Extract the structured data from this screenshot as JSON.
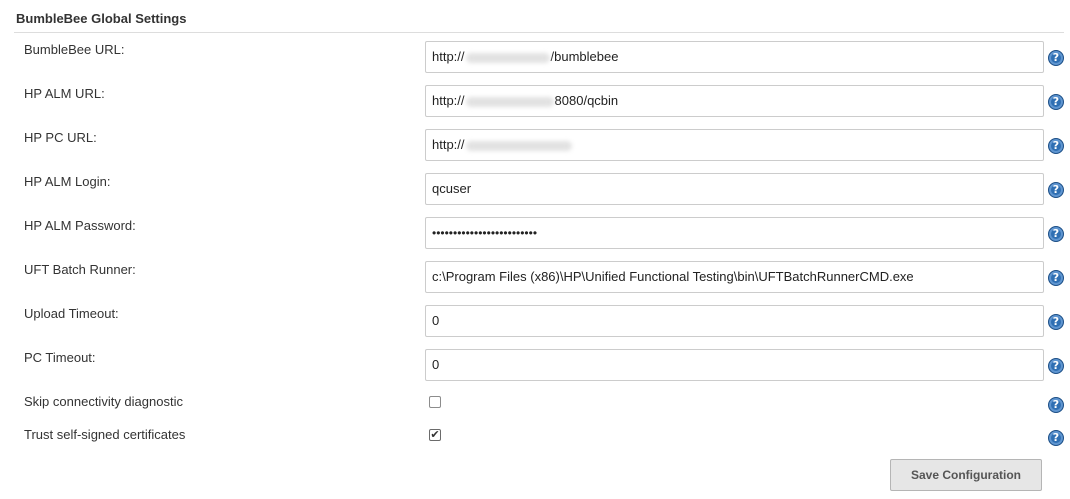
{
  "section": {
    "title": "BumbleBee Global Settings"
  },
  "fields": {
    "bumblebee_url": {
      "label": "BumbleBee URL:",
      "prefix": "http://",
      "suffix": "/bumblebee"
    },
    "alm_url": {
      "label": "HP ALM URL:",
      "prefix": "http://",
      "suffix": "8080/qcbin"
    },
    "pc_url": {
      "label": "HP PC URL:",
      "prefix": "http://",
      "suffix": ""
    },
    "alm_login": {
      "label": "HP ALM Login:",
      "value": "qcuser"
    },
    "alm_password": {
      "label": "HP ALM Password:",
      "value": "•••••••••••••••••••••••••"
    },
    "uft_runner": {
      "label": "UFT Batch Runner:",
      "value": "c:\\Program Files (x86)\\HP\\Unified Functional Testing\\bin\\UFTBatchRunnerCMD.exe"
    },
    "upload_timeout": {
      "label": "Upload Timeout:",
      "value": "0"
    },
    "pc_timeout": {
      "label": "PC Timeout:",
      "value": "0"
    },
    "skip_diagnostic": {
      "label": "Skip connectivity diagnostic",
      "checked": false
    },
    "trust_certs": {
      "label": "Trust self-signed certificates",
      "checked": true,
      "check_glyph": "✔"
    }
  },
  "help_icon": {
    "glyph": "?",
    "color": "#2f6fb3"
  },
  "buttons": {
    "save_label": "Save Configuration"
  }
}
